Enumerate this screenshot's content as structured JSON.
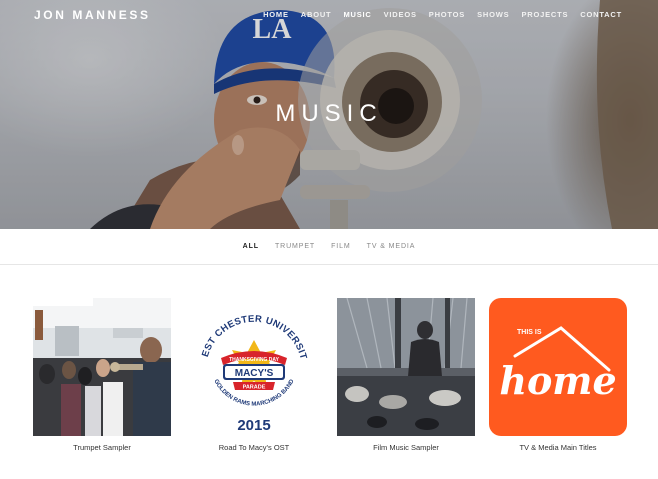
{
  "site": {
    "brand": "JON MANNESS",
    "nav": [
      "HOME",
      "ABOUT",
      "MUSIC",
      "VIDEOS",
      "PHOTOS",
      "SHOWS",
      "PROJECTS",
      "CONTACT"
    ],
    "active_nav": "MUSIC"
  },
  "hero": {
    "title": "MUSIC",
    "cap_logo": "LA"
  },
  "filters": [
    "ALL",
    "TRUMPET",
    "FILM",
    "TV & MEDIA"
  ],
  "active_filter": "ALL",
  "items": [
    {
      "caption": "Trumpet Sampler"
    },
    {
      "caption": "Road To Macy's OST",
      "logo": {
        "arc_top": "WEST CHESTER UNIVERSITY",
        "banner_top": "THANKSGIVING DAY",
        "center": "MACY'S",
        "banner_bottom": "PARADE",
        "arc_bottom": "GOLDEN RAMS MARCHING BAND",
        "year": "2015"
      }
    },
    {
      "caption": "Film Music Sampler"
    },
    {
      "caption": "TV & Media Main Titles",
      "logo": {
        "small": "THIS IS",
        "script": "home"
      }
    }
  ],
  "colors": {
    "orange": "#ff5a1f",
    "navy": "#1f3a78",
    "red": "#d8242b",
    "gold": "#f2b718"
  }
}
